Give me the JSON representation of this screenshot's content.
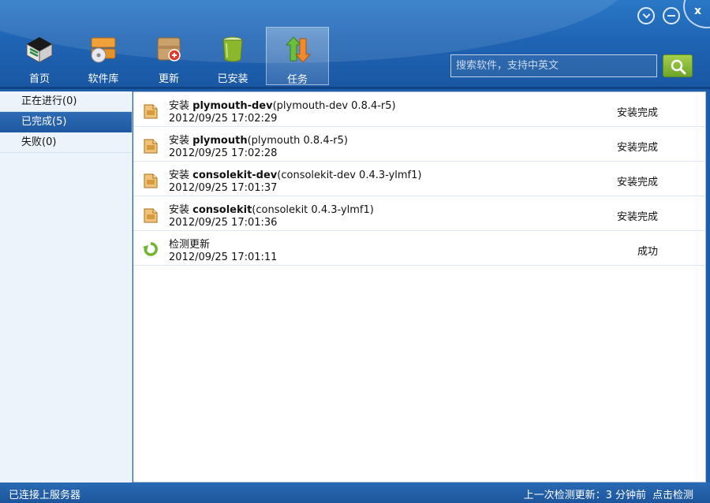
{
  "nav": {
    "items": [
      {
        "label": "首页",
        "icon": "home-icon"
      },
      {
        "label": "软件库",
        "icon": "software-library-icon"
      },
      {
        "label": "更新",
        "icon": "update-icon"
      },
      {
        "label": "已安装",
        "icon": "installed-icon"
      },
      {
        "label": "任务",
        "icon": "task-icon"
      }
    ],
    "active": "任务"
  },
  "search": {
    "placeholder": "搜索软件，支持中英文",
    "button_icon": "search-icon"
  },
  "window_controls": [
    "minimize-icon",
    "collapse-icon",
    "close-icon"
  ],
  "sidebar": {
    "items": [
      {
        "label": "正在进行(0)"
      },
      {
        "label": "已完成(5)"
      },
      {
        "label": "失败(0)"
      }
    ],
    "selected": "已完成(5)"
  },
  "tasks": [
    {
      "prefix": "安装 ",
      "name": "plymouth-dev",
      "detail": "(plymouth-dev 0.8.4-r5)",
      "time": "2012/09/25 17:02:29",
      "status": "安装完成",
      "icon": "package-icon"
    },
    {
      "prefix": "安装 ",
      "name": "plymouth",
      "detail": "(plymouth 0.8.4-r5)",
      "time": "2012/09/25 17:02:28",
      "status": "安装完成",
      "icon": "package-icon"
    },
    {
      "prefix": "安装 ",
      "name": "consolekit-dev",
      "detail": "(consolekit-dev 0.4.3-ylmf1)",
      "time": "2012/09/25 17:01:37",
      "status": "安装完成",
      "icon": "package-icon"
    },
    {
      "prefix": "安装 ",
      "name": "consolekit",
      "detail": "(consolekit 0.4.3-ylmf1)",
      "time": "2012/09/25 17:01:36",
      "status": "安装完成",
      "icon": "package-icon"
    },
    {
      "prefix": "检测更新",
      "name": "",
      "detail": "",
      "time": "2012/09/25 17:01:11",
      "status": "成功",
      "icon": "refresh-icon"
    }
  ],
  "statusbar": {
    "left": "已连接上服务器",
    "last_check": "上一次检测更新：3 分钟前",
    "check_link": "点击检测"
  },
  "colors": {
    "header": "#1f64b4",
    "sidebar_selected": "#1f5aa1",
    "search_button": "#8bbd3a"
  }
}
